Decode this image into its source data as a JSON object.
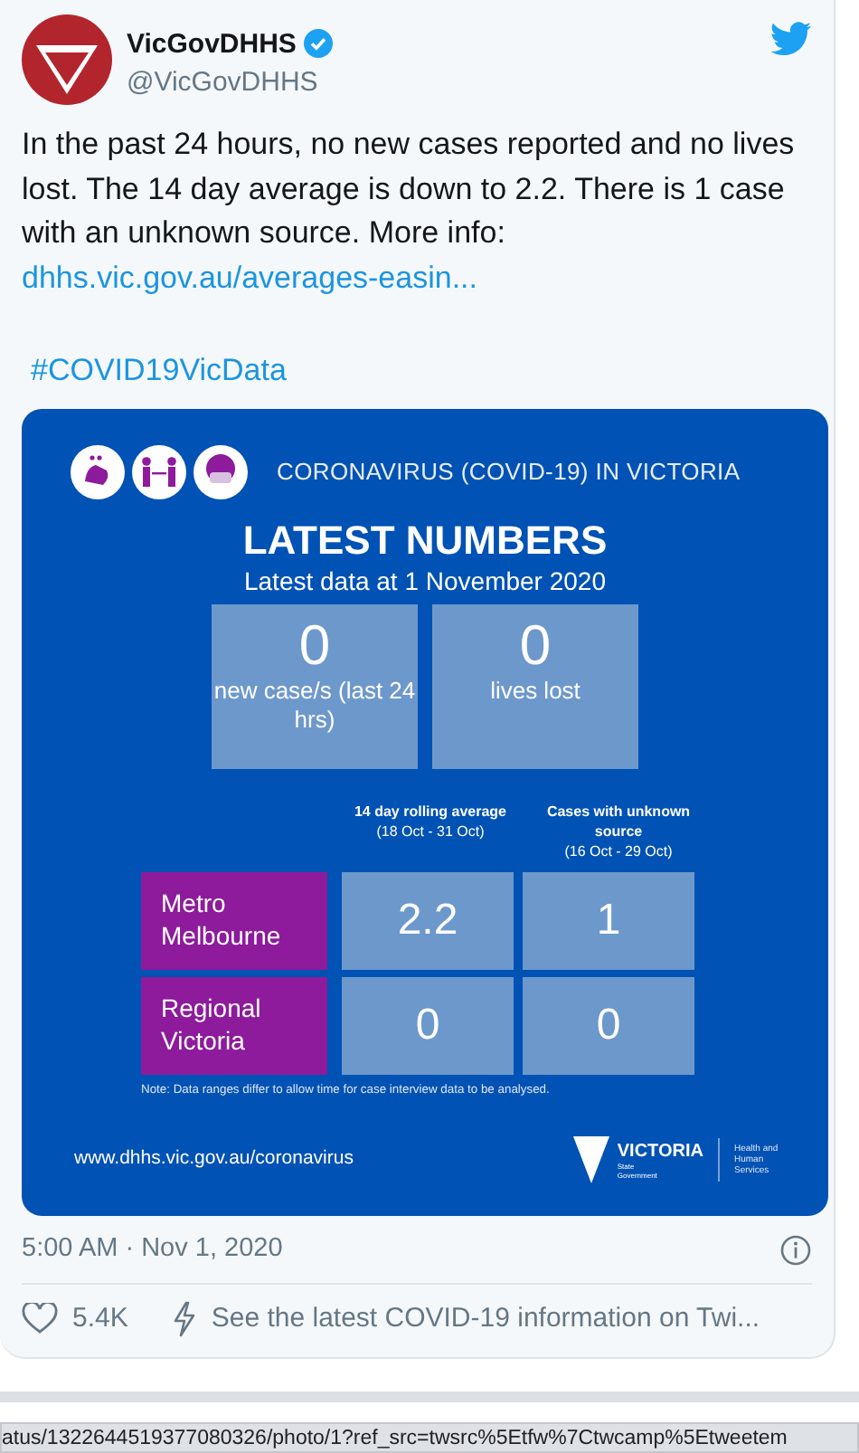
{
  "author": {
    "name": "VicGovDHHS",
    "handle": "@VicGovDHHS",
    "verified": true
  },
  "tweet": {
    "text": "In the past 24 hours, no new cases reported and no lives lost. The 14 day average is down to 2.2. There is 1 case with an unknown source. More info: ",
    "link": "dhhs.vic.gov.au/averages-easin...",
    "hashtag": "#COVID19VicData"
  },
  "infographic": {
    "header": "CORONAVIRUS (COVID-19) IN VICTORIA",
    "title": "LATEST NUMBERS",
    "subtitle": "Latest data at 1 November 2020",
    "stats": [
      {
        "value": "0",
        "label": "new case/s (last 24 hrs)"
      },
      {
        "value": "0",
        "label": "lives lost"
      }
    ],
    "columns": [
      {
        "title": "14 day rolling average",
        "range": "(18 Oct -  31 Oct)"
      },
      {
        "title": "Cases with unknown source",
        "range": "(16 Oct -  29 Oct)"
      }
    ],
    "rows": [
      {
        "region": "Metro Melbourne",
        "values": [
          "2.2",
          "1"
        ]
      },
      {
        "region": "Regional Victoria",
        "values": [
          "0",
          "0"
        ]
      }
    ],
    "note": "Note: Data ranges differ to allow time for case interview data to be analysed.",
    "footer_url": "www.dhhs.vic.gov.au/coronavirus",
    "logo": {
      "name": "VICTORIA",
      "sub": "State Government",
      "department": "Health and Human Services"
    }
  },
  "timestamp": "5:00 AM · Nov 1, 2020",
  "likes": "5.4K",
  "info_link": "See the latest COVID-19 information on Twi...",
  "status_bar": {
    "url": "atus/1322644519377080326/photo/1?ref_src=twsrc%5Etfw%7Ctwcamp%5Etweetem"
  }
}
